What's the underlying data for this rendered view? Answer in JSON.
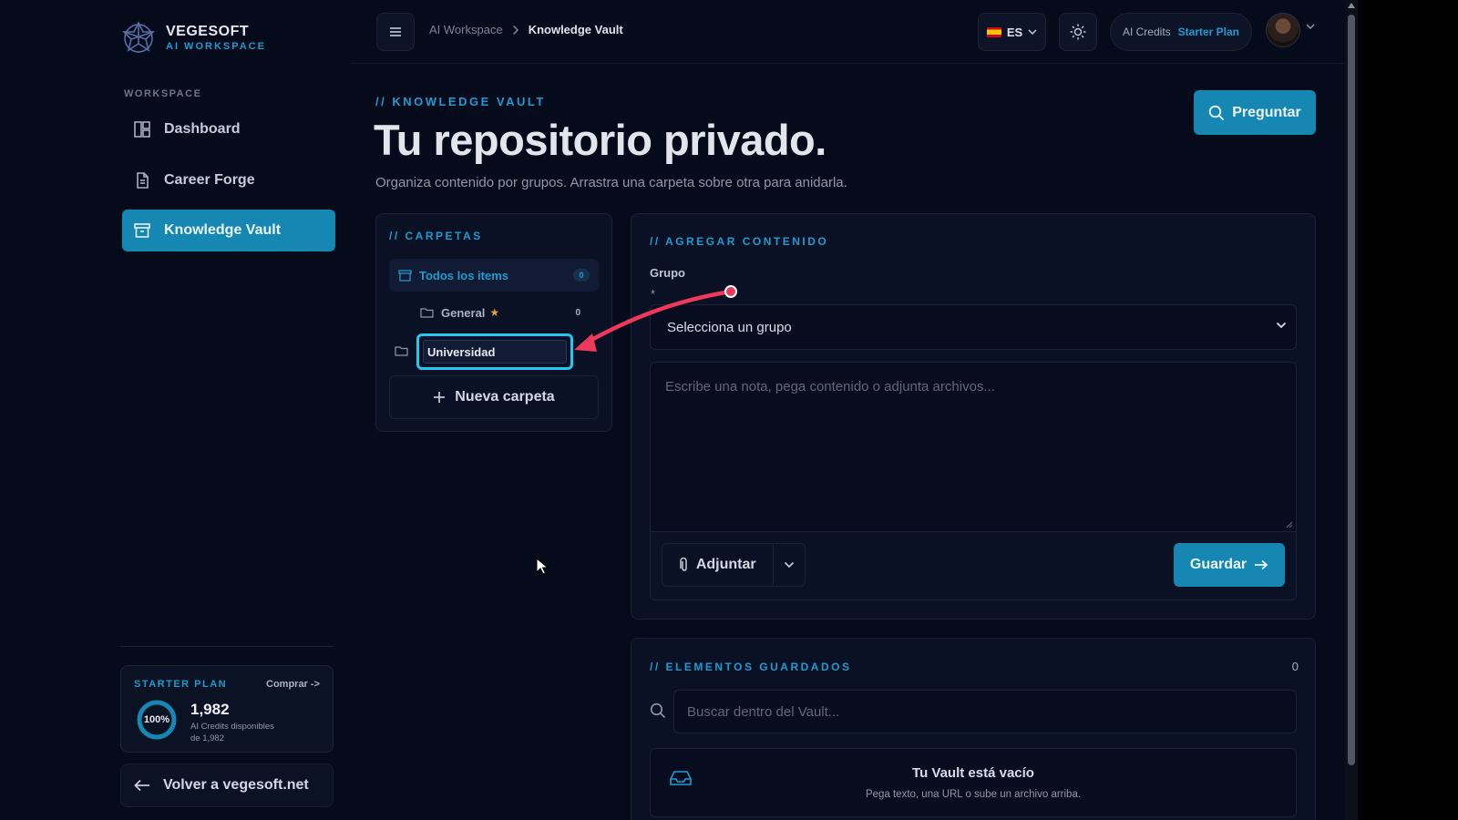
{
  "brand": {
    "name": "VEGESOFT",
    "subtitle": "AI WORKSPACE"
  },
  "sidebar": {
    "section_label": "WORKSPACE",
    "items": [
      {
        "label": "Dashboard",
        "icon": "layout-grid-icon",
        "active": false
      },
      {
        "label": "Career Forge",
        "icon": "document-icon",
        "active": false
      },
      {
        "label": "Knowledge Vault",
        "icon": "archive-icon",
        "active": true
      }
    ],
    "plan": {
      "title": "STARTER PLAN",
      "buy_label": "Comprar ->",
      "percent_label": "100%",
      "percent": 100,
      "amount": "1,982",
      "desc_line1": "AI Credits disponibles",
      "desc_line2": "de 1,982"
    },
    "back_label": "Volver a vegesoft.net"
  },
  "topbar": {
    "breadcrumb": [
      "AI Workspace",
      "Knowledge Vault"
    ],
    "language": "ES",
    "credits_label": "AI Credits",
    "credits_plan": "Starter Plan"
  },
  "header": {
    "eyebrow": "// KNOWLEDGE VAULT",
    "title": "Tu repositorio privado.",
    "subtitle": "Organiza contenido por grupos. Arrastra una carpeta sobre otra para anidarla.",
    "ask_label": "Preguntar"
  },
  "folders": {
    "title": "// CARPETAS",
    "all_items_label": "Todos los items",
    "all_items_count": "0",
    "general_label": "General",
    "general_count": "0",
    "new_folder_value": "Universidad",
    "new_folder_button": "Nueva carpeta"
  },
  "add_content": {
    "title": "// AGREGAR CONTENIDO",
    "group_label": "Grupo",
    "required_mark": "*",
    "group_select_value": "Selecciona un grupo",
    "note_placeholder": "Escribe una nota, pega contenido o adjunta archivos...",
    "attach_label": "Adjuntar",
    "save_label": "Guardar"
  },
  "saved": {
    "title": "// ELEMENTOS GUARDADOS",
    "count": "0",
    "search_placeholder": "Buscar dentro del Vault...",
    "empty_title": "Tu Vault está vacío",
    "empty_desc": "Pega texto, una URL o sube un archivo arriba."
  },
  "colors": {
    "accent": "#1686b3",
    "accent_text": "#1e9bd0",
    "background": "#060b1c",
    "panel": "#0a1124",
    "highlight": "#25c6ef",
    "annotation": "#f0385a"
  }
}
